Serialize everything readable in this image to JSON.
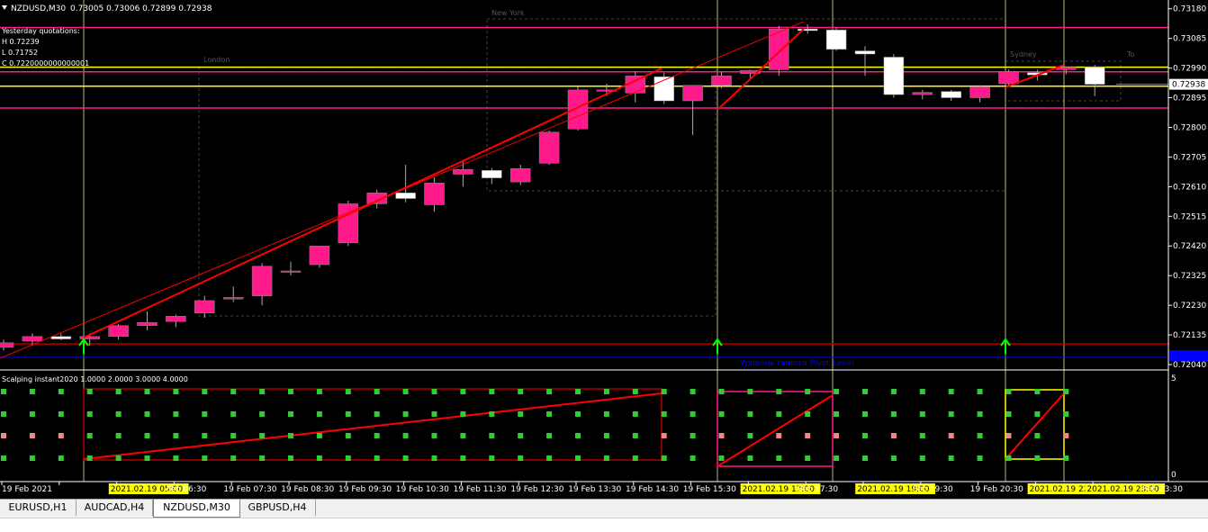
{
  "header": {
    "symbol": "NZDUSD,M30",
    "ohlc": "0.73005 0.73006 0.72899 0.72938",
    "yesterday_title": "Yesterday quotations:",
    "yesterday_high": "H 0.72239",
    "yesterday_low": "L 0.71752",
    "yesterday_close": "C 0.7220000000000001"
  },
  "sessions": {
    "london": "London",
    "newyork": "New York",
    "sydney": "Sydney",
    "tokyo": "To"
  },
  "pivot_label": "Уровень пивота Pivot Level",
  "indicator": {
    "title": "Scalping instant2020 1.0000 2.0000 3.0000 4.0000",
    "scale_top": "5",
    "scale_bottom": "0"
  },
  "colors": {
    "bull": "#ff1a8c",
    "bear": "#ffffff",
    "level_yellow": "#ffff00",
    "level_pink": "#ff1a8c",
    "trend": "#ff0000",
    "arrow": "#00ff00",
    "pivot": "#0000ff"
  },
  "chart_data": {
    "type": "candlestick",
    "symbol": "NZDUSD",
    "timeframe": "M30",
    "ylim": [
      0.7204,
      0.73185
    ],
    "y_ticks": [
      "0.73180",
      "0.73085",
      "0.72990",
      "0.72895",
      "0.72800",
      "0.72705",
      "0.72610",
      "0.72515",
      "0.72420",
      "0.72325",
      "0.72230",
      "0.72135",
      "0.72040"
    ],
    "current_price": "0.72938",
    "pivot_price": "0.72040",
    "horizontal_levels": [
      {
        "price": 0.7312,
        "color": "#ff1a8c"
      },
      {
        "price": 0.72993,
        "color": "#ffff00"
      },
      {
        "price": 0.72978,
        "color": "#ff1a8c"
      },
      {
        "price": 0.72932,
        "color": "#ffff00"
      },
      {
        "price": 0.72862,
        "color": "#ff1a8c"
      },
      {
        "price": 0.72106,
        "color": "#b00000"
      }
    ],
    "candles": [
      {
        "o": 0.72095,
        "h": 0.7212,
        "l": 0.72085,
        "c": 0.7211
      },
      {
        "o": 0.72115,
        "h": 0.7214,
        "l": 0.721,
        "c": 0.7213
      },
      {
        "o": 0.7213,
        "h": 0.7214,
        "l": 0.72118,
        "c": 0.72122
      },
      {
        "o": 0.72122,
        "h": 0.7214,
        "l": 0.721,
        "c": 0.7213
      },
      {
        "o": 0.7213,
        "h": 0.7217,
        "l": 0.7212,
        "c": 0.72165
      },
      {
        "o": 0.72165,
        "h": 0.7221,
        "l": 0.7215,
        "c": 0.72175
      },
      {
        "o": 0.72178,
        "h": 0.722,
        "l": 0.7216,
        "c": 0.72195
      },
      {
        "o": 0.72205,
        "h": 0.7226,
        "l": 0.7219,
        "c": 0.72245
      },
      {
        "o": 0.7225,
        "h": 0.7229,
        "l": 0.7224,
        "c": 0.72255
      },
      {
        "o": 0.7226,
        "h": 0.72365,
        "l": 0.7223,
        "c": 0.72355
      },
      {
        "o": 0.7234,
        "h": 0.7237,
        "l": 0.72325,
        "c": 0.7234
      },
      {
        "o": 0.7236,
        "h": 0.7242,
        "l": 0.7235,
        "c": 0.7242
      },
      {
        "o": 0.7243,
        "h": 0.72565,
        "l": 0.7242,
        "c": 0.72555
      },
      {
        "o": 0.72555,
        "h": 0.726,
        "l": 0.7254,
        "c": 0.7259
      },
      {
        "o": 0.7259,
        "h": 0.7268,
        "l": 0.7256,
        "c": 0.72572
      },
      {
        "o": 0.72552,
        "h": 0.7264,
        "l": 0.7253,
        "c": 0.72622
      },
      {
        "o": 0.7265,
        "h": 0.7269,
        "l": 0.7261,
        "c": 0.72665
      },
      {
        "o": 0.72662,
        "h": 0.7267,
        "l": 0.72618,
        "c": 0.72638
      },
      {
        "o": 0.72625,
        "h": 0.7268,
        "l": 0.72615,
        "c": 0.72668
      },
      {
        "o": 0.72685,
        "h": 0.7279,
        "l": 0.7268,
        "c": 0.72785
      },
      {
        "o": 0.72795,
        "h": 0.7293,
        "l": 0.7279,
        "c": 0.7292
      },
      {
        "o": 0.7292,
        "h": 0.7294,
        "l": 0.729,
        "c": 0.7292
      },
      {
        "o": 0.7291,
        "h": 0.7298,
        "l": 0.7288,
        "c": 0.72965
      },
      {
        "o": 0.72962,
        "h": 0.72975,
        "l": 0.72875,
        "c": 0.72885
      },
      {
        "o": 0.72885,
        "h": 0.7293,
        "l": 0.72775,
        "c": 0.72935
      },
      {
        "o": 0.72935,
        "h": 0.72978,
        "l": 0.72925,
        "c": 0.72965
      },
      {
        "o": 0.72972,
        "h": 0.72985,
        "l": 0.72955,
        "c": 0.72982
      },
      {
        "o": 0.72985,
        "h": 0.73125,
        "l": 0.72965,
        "c": 0.73115
      },
      {
        "o": 0.73115,
        "h": 0.7313,
        "l": 0.731,
        "c": 0.7311
      },
      {
        "o": 0.73112,
        "h": 0.7312,
        "l": 0.73045,
        "c": 0.7305
      },
      {
        "o": 0.73045,
        "h": 0.7306,
        "l": 0.72965,
        "c": 0.73035
      },
      {
        "o": 0.73025,
        "h": 0.73035,
        "l": 0.72895,
        "c": 0.72905
      },
      {
        "o": 0.72905,
        "h": 0.7292,
        "l": 0.7289,
        "c": 0.72912
      },
      {
        "o": 0.72915,
        "h": 0.7292,
        "l": 0.72885,
        "c": 0.72895
      },
      {
        "o": 0.72895,
        "h": 0.72935,
        "l": 0.7288,
        "c": 0.7293
      },
      {
        "o": 0.7294,
        "h": 0.72985,
        "l": 0.7293,
        "c": 0.72978
      },
      {
        "o": 0.72975,
        "h": 0.72985,
        "l": 0.7295,
        "c": 0.72968
      },
      {
        "o": 0.72985,
        "h": 0.72995,
        "l": 0.7297,
        "c": 0.72993
      },
      {
        "o": 0.72993,
        "h": 0.73,
        "l": 0.729,
        "c": 0.72938
      }
    ],
    "x_tick_labels": [
      "19 Feb 2021",
      "2021.02.19 05:00",
      "Feb 06:30",
      "19 Feb 07:30",
      "19 Feb 08:30",
      "19 Feb 09:30",
      "19 Feb 10:30",
      "19 Feb 11:30",
      "19 Feb 12:30",
      "19 Feb 13:30",
      "19 Feb 14:30",
      "19 Feb 15:30",
      "2021.02.19 17:00",
      "Feb 17:30",
      "2021.02.19 19:00",
      "Feb 19:30",
      "19 Feb 20:30",
      "2021.02.19 22",
      "2021.02.19 23:00",
      "Feb 23:30"
    ],
    "x_tick_highlighted": [
      false,
      true,
      false,
      false,
      false,
      false,
      false,
      false,
      false,
      false,
      false,
      false,
      true,
      false,
      true,
      false,
      false,
      true,
      true,
      false
    ],
    "arrow_candles": [
      2,
      24,
      34
    ]
  },
  "tabs": [
    {
      "label": "EURUSD,H1",
      "active": false
    },
    {
      "label": "AUDCAD,H4",
      "active": false
    },
    {
      "label": "NZDUSD,M30",
      "active": true
    },
    {
      "label": "GBPUSD,H4",
      "active": false
    }
  ]
}
